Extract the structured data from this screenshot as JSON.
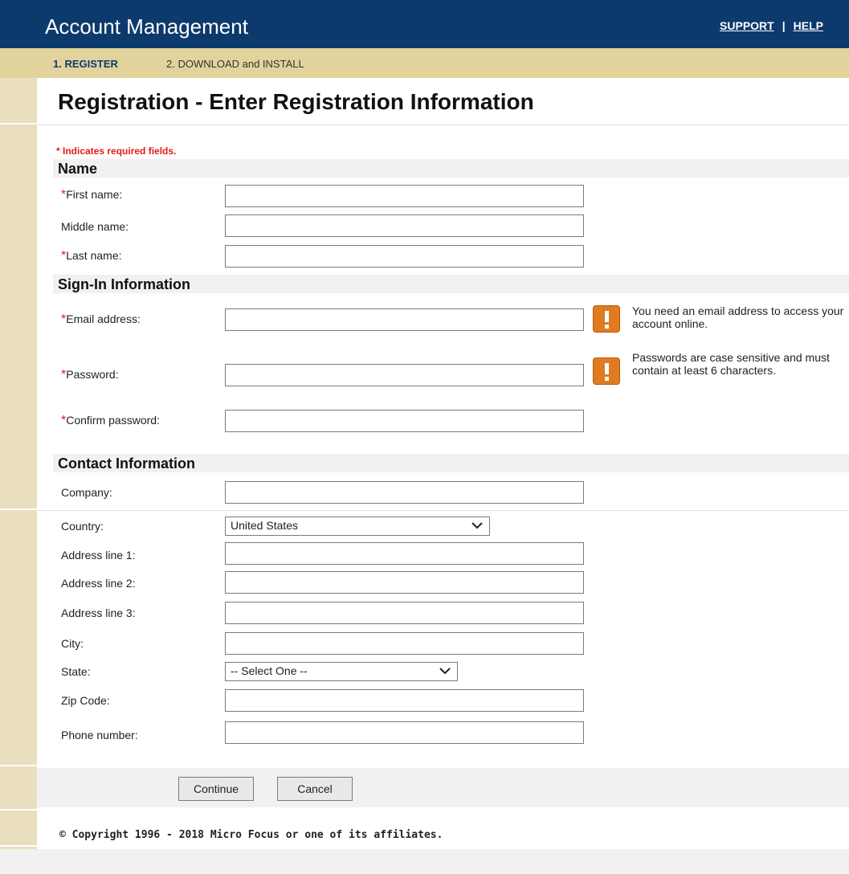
{
  "header": {
    "title": "Account Management",
    "support": "SUPPORT",
    "separator": "|",
    "help": "HELP"
  },
  "steps": {
    "step1": "1. REGISTER",
    "step2": "2. DOWNLOAD and INSTALL"
  },
  "page": {
    "title": "Registration - Enter Registration Information",
    "required_note": "* Indicates required fields."
  },
  "sections": {
    "name": "Name",
    "signin": "Sign-In Information",
    "contact": "Contact Information"
  },
  "fields": {
    "first_name": "First name:",
    "middle_name": "Middle name:",
    "last_name": "Last name:",
    "email": "Email address:",
    "password": "Password:",
    "confirm_password": "Confirm password:",
    "company": "Company:",
    "country": "Country:",
    "address1": "Address line 1:",
    "address2": "Address line 2:",
    "address3": "Address line 3:",
    "city": "City:",
    "state": "State:",
    "zip": "Zip Code:",
    "phone": "Phone number:"
  },
  "selects": {
    "country_value": "United States",
    "state_value": "-- Select One --"
  },
  "hints": {
    "email": "You need an email address to access your account online.",
    "password": "Passwords are case sensitive and must contain at least 6 characters."
  },
  "required_star": "*",
  "buttons": {
    "continue": "Continue",
    "cancel": "Cancel"
  },
  "footer": {
    "copyright": "© Copyright 1996 - 2018 Micro Focus or one of its affiliates."
  },
  "colors": {
    "header_bg": "#0c3a6d",
    "steps_bg": "#e2d39c",
    "required_red": "#e31b1b",
    "warning_orange": "#e07b1f"
  }
}
